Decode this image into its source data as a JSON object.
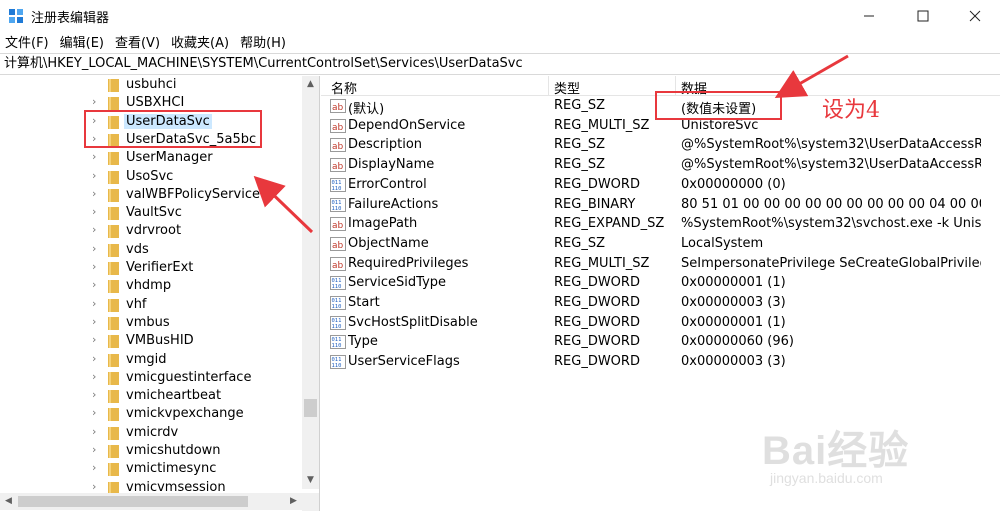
{
  "window": {
    "title": "注册表编辑器",
    "minimize_icon": "minimize-icon",
    "maximize_icon": "maximize-icon",
    "close_icon": "close-icon"
  },
  "menu": [
    "文件(F)",
    "编辑(E)",
    "查看(V)",
    "收藏夹(A)",
    "帮助(H)"
  ],
  "address": "计算机\\HKEY_LOCAL_MACHINE\\SYSTEM\\CurrentControlSet\\Services\\UserDataSvc",
  "tree": {
    "items": [
      {
        "label": "usbuhci",
        "selected": false
      },
      {
        "label": "USBXHCI",
        "selected": false
      },
      {
        "label": "UserDataSvc",
        "selected": true
      },
      {
        "label": "UserDataSvc_5a5bc",
        "selected": false
      },
      {
        "label": "UserManager",
        "selected": false
      },
      {
        "label": "UsoSvc",
        "selected": false
      },
      {
        "label": "valWBFPolicyService",
        "selected": false
      },
      {
        "label": "VaultSvc",
        "selected": false
      },
      {
        "label": "vdrvroot",
        "selected": false
      },
      {
        "label": "vds",
        "selected": false
      },
      {
        "label": "VerifierExt",
        "selected": false
      },
      {
        "label": "vhdmp",
        "selected": false
      },
      {
        "label": "vhf",
        "selected": false
      },
      {
        "label": "vmbus",
        "selected": false
      },
      {
        "label": "VMBusHID",
        "selected": false
      },
      {
        "label": "vmgid",
        "selected": false
      },
      {
        "label": "vmicguestinterface",
        "selected": false
      },
      {
        "label": "vmicheartbeat",
        "selected": false
      },
      {
        "label": "vmickvpexchange",
        "selected": false
      },
      {
        "label": "vmicrdv",
        "selected": false
      },
      {
        "label": "vmicshutdown",
        "selected": false
      },
      {
        "label": "vmictimesync",
        "selected": false
      },
      {
        "label": "vmicvmsession",
        "selected": false
      }
    ]
  },
  "list": {
    "headers": {
      "name": "名称",
      "type": "类型",
      "data": "数据"
    },
    "rows": [
      {
        "icon": "string-value-icon",
        "name": "(默认)",
        "type": "REG_SZ",
        "data": "(数值未设置)"
      },
      {
        "icon": "string-value-icon",
        "name": "DependOnService",
        "type": "REG_MULTI_SZ",
        "data": "UnistoreSvc"
      },
      {
        "icon": "string-value-icon",
        "name": "Description",
        "type": "REG_SZ",
        "data": "@%SystemRoot%\\system32\\UserDataAccessRe..."
      },
      {
        "icon": "string-value-icon",
        "name": "DisplayName",
        "type": "REG_SZ",
        "data": "@%SystemRoot%\\system32\\UserDataAccessRe..."
      },
      {
        "icon": "binary-value-icon",
        "name": "ErrorControl",
        "type": "REG_DWORD",
        "data": "0x00000000 (0)"
      },
      {
        "icon": "binary-value-icon",
        "name": "FailureActions",
        "type": "REG_BINARY",
        "data": "80 51 01 00 00 00 00 00 00 00 00 00 04 00 00 ..."
      },
      {
        "icon": "string-value-icon",
        "name": "ImagePath",
        "type": "REG_EXPAND_SZ",
        "data": "%SystemRoot%\\system32\\svchost.exe -k Unist..."
      },
      {
        "icon": "string-value-icon",
        "name": "ObjectName",
        "type": "REG_SZ",
        "data": "LocalSystem"
      },
      {
        "icon": "string-value-icon",
        "name": "RequiredPrivileges",
        "type": "REG_MULTI_SZ",
        "data": "SeImpersonatePrivilege SeCreateGlobalPrivilege"
      },
      {
        "icon": "binary-value-icon",
        "name": "ServiceSidType",
        "type": "REG_DWORD",
        "data": "0x00000001 (1)"
      },
      {
        "icon": "binary-value-icon",
        "name": "Start",
        "type": "REG_DWORD",
        "data": "0x00000003 (3)"
      },
      {
        "icon": "binary-value-icon",
        "name": "SvcHostSplitDisable",
        "type": "REG_DWORD",
        "data": "0x00000001 (1)"
      },
      {
        "icon": "binary-value-icon",
        "name": "Type",
        "type": "REG_DWORD",
        "data": "0x00000060 (96)"
      },
      {
        "icon": "binary-value-icon",
        "name": "UserServiceFlags",
        "type": "REG_DWORD",
        "data": "0x00000003 (3)"
      }
    ]
  },
  "annotation": {
    "text": "设为4",
    "color": "#e8383d"
  },
  "watermark": {
    "brand": "Bai经验",
    "url": "jingyan.baidu.com"
  },
  "colors": {
    "selection": "#cce8ff",
    "folder": "#e8b84a",
    "annotation": "#e8383d"
  }
}
